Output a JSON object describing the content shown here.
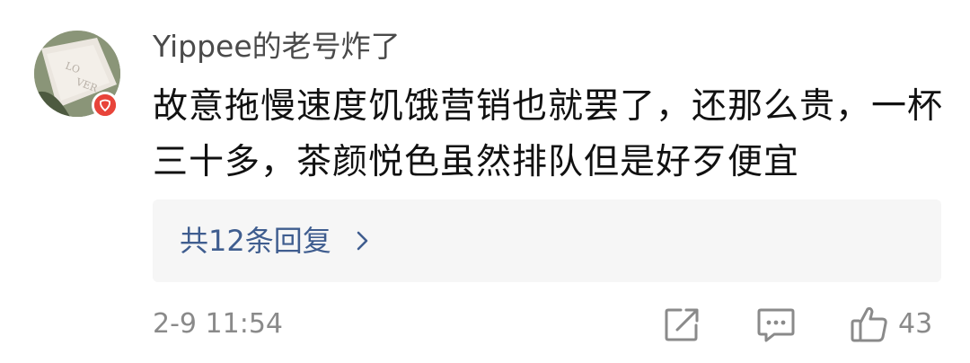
{
  "comment": {
    "username": "Yippee的老号炸了",
    "text": "故意拖慢速度饥饿营销也就罢了，还那么贵，一杯三十多，茶颜悦色虽然排队但是好歹便宜",
    "replies_label": "共12条回复",
    "timestamp": "2-9 11:54",
    "like_count": "43"
  },
  "icons": {
    "share": "share-edit-icon",
    "comment": "comment-icon",
    "like": "thumbs-up-icon",
    "chevron": "chevron-right-icon",
    "avatar_badge": "verified-badge-icon"
  },
  "colors": {
    "link": "#3f5d8f",
    "meta": "#8a8a8a",
    "reply_bg": "#f6f6f6",
    "badge": "#e8443a"
  }
}
